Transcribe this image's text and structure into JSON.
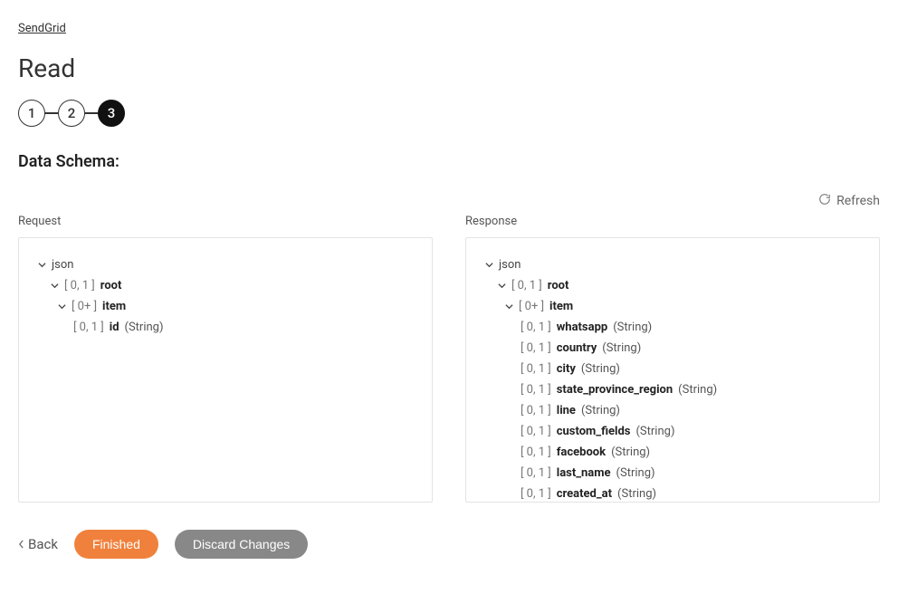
{
  "breadcrumb": "SendGrid",
  "pageTitle": "Read",
  "steps": [
    "1",
    "2",
    "3"
  ],
  "activeStep": 3,
  "sectionTitle": "Data Schema:",
  "refreshLabel": "Refresh",
  "request": {
    "label": "Request",
    "tree": {
      "jsonLabel": "json",
      "root": {
        "card": "[ 0, 1 ]",
        "name": "root"
      },
      "item": {
        "card": "[ 0+ ]",
        "name": "item"
      },
      "fields": [
        {
          "card": "[ 0, 1 ]",
          "name": "id",
          "type": "(String)"
        }
      ]
    }
  },
  "response": {
    "label": "Response",
    "tree": {
      "jsonLabel": "json",
      "root": {
        "card": "[ 0, 1 ]",
        "name": "root"
      },
      "item": {
        "card": "[ 0+ ]",
        "name": "item"
      },
      "fields": [
        {
          "card": "[ 0, 1 ]",
          "name": "whatsapp",
          "type": "(String)"
        },
        {
          "card": "[ 0, 1 ]",
          "name": "country",
          "type": "(String)"
        },
        {
          "card": "[ 0, 1 ]",
          "name": "city",
          "type": "(String)"
        },
        {
          "card": "[ 0, 1 ]",
          "name": "state_province_region",
          "type": "(String)"
        },
        {
          "card": "[ 0, 1 ]",
          "name": "line",
          "type": "(String)"
        },
        {
          "card": "[ 0, 1 ]",
          "name": "custom_fields",
          "type": "(String)"
        },
        {
          "card": "[ 0, 1 ]",
          "name": "facebook",
          "type": "(String)"
        },
        {
          "card": "[ 0, 1 ]",
          "name": "last_name",
          "type": "(String)"
        },
        {
          "card": "[ 0, 1 ]",
          "name": "created_at",
          "type": "(String)"
        }
      ]
    }
  },
  "footer": {
    "back": "Back",
    "finished": "Finished",
    "discard": "Discard Changes"
  }
}
